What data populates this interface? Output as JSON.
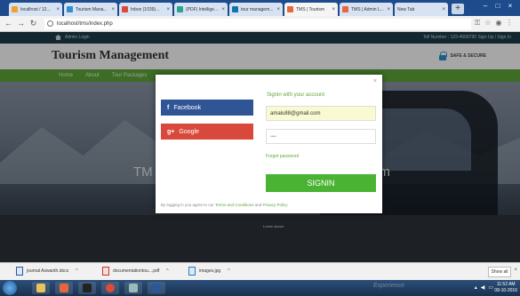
{
  "browser": {
    "tabs": [
      {
        "label": "localhost / 12...",
        "color": "#f0a030"
      },
      {
        "label": "Tourism Mana...",
        "color": "#2f8fcf"
      },
      {
        "label": "Inbox (1039)...",
        "color": "#d9493b"
      },
      {
        "label": "(PDF) Intellige...",
        "color": "#2aa58f"
      },
      {
        "label": "tour managem...",
        "color": "#0e76a8"
      },
      {
        "label": "TMS | Tourism",
        "color": "#e8663d",
        "active": true
      },
      {
        "label": "TMS | Admin L...",
        "color": "#e8663d"
      },
      {
        "label": "New Tab",
        "color": "#cccccc"
      }
    ],
    "url": "localhost/tms/index.php"
  },
  "site": {
    "admin_login": "Admin Login",
    "toll_signup": "Toll Number : 123-4568790   Sign Up / Sign In",
    "brand": "Tourism Management",
    "safe_secure": "SAFE & SECURE",
    "menu": [
      "Home",
      "About",
      "Tour Packages"
    ],
    "hero_text_left": "TM",
    "hero_text_right": "em",
    "bus_label": "Lorem Ipsum"
  },
  "modal": {
    "facebook_label": "Facebook",
    "google_label": "Google",
    "title": "Signin with your account",
    "email_value": "amalu88@gmail.com",
    "password_placeholder": "••••",
    "forgot": "Forgot password",
    "signin_button": "SIGNIN",
    "terms_prefix": "By logging in you agree to our",
    "terms_link": "Terms and Conditions",
    "terms_and": "and",
    "privacy_link": "Privacy Policy"
  },
  "downloads": {
    "items": [
      "journal Aswanth.docx",
      "documentationtou....pdf",
      "images.jpg"
    ],
    "show_all": "Show all"
  },
  "taskbar": {
    "watermark": "Experience",
    "time": "11:52 AM",
    "date": "08-10-2016"
  }
}
